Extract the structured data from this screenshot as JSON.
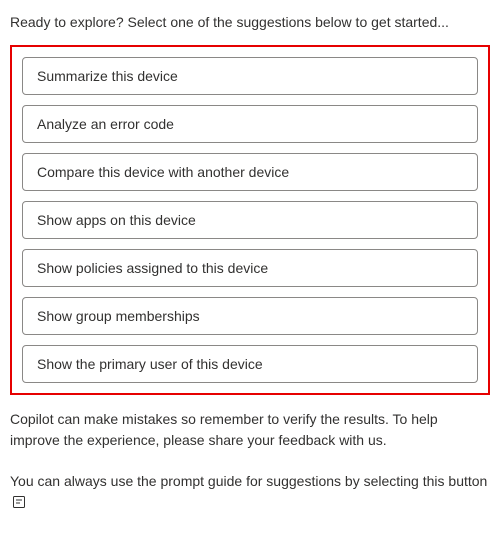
{
  "intro": "Ready to explore? Select one of the suggestions below to get started...",
  "suggestions": [
    {
      "label": "Summarize this device"
    },
    {
      "label": "Analyze an error code"
    },
    {
      "label": "Compare this device with another device"
    },
    {
      "label": "Show apps on this device"
    },
    {
      "label": "Show policies assigned to this device"
    },
    {
      "label": "Show group memberships"
    },
    {
      "label": "Show the primary user of this device"
    }
  ],
  "disclaimer": "Copilot can make mistakes so remember to verify the results. To help improve the experience, please share your feedback with us.",
  "promptGuide": {
    "text": "You can always use the prompt guide for suggestions by selecting this button",
    "iconName": "prompt-guide-icon"
  }
}
